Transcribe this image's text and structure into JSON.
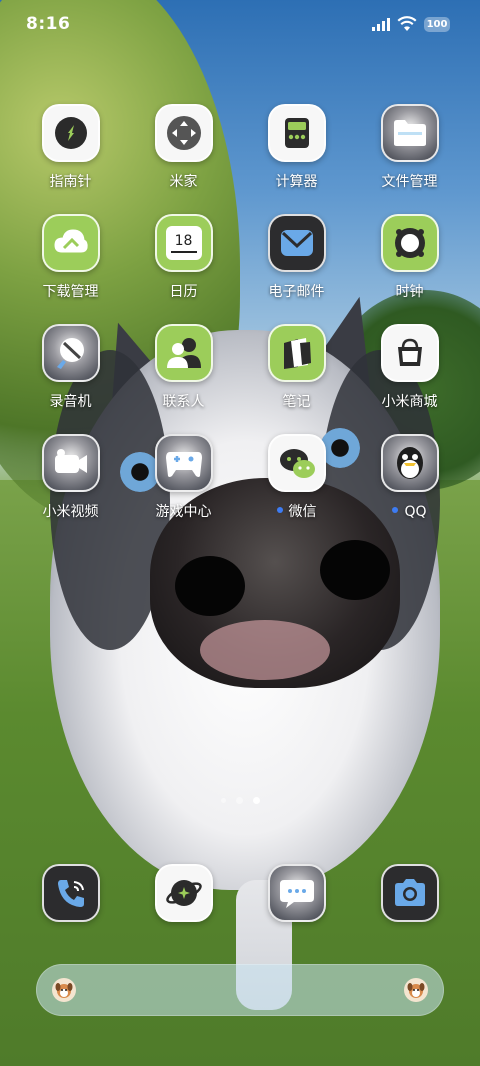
{
  "status_bar": {
    "time": "8:16",
    "battery": "100",
    "signal_icon": "cellular-signal-icon",
    "wifi_icon": "wifi-icon"
  },
  "apps": [
    {
      "label": "指南针",
      "icon": "compass-icon",
      "tile": "white",
      "dot": false
    },
    {
      "label": "米家",
      "icon": "mi-home-icon",
      "tile": "white",
      "dot": false
    },
    {
      "label": "计算器",
      "icon": "calculator-icon",
      "tile": "white",
      "dot": false
    },
    {
      "label": "文件管理",
      "icon": "folder-icon",
      "tile": "photo",
      "dot": false
    },
    {
      "label": "下载管理",
      "icon": "download-cloud-icon",
      "tile": "lime",
      "dot": false
    },
    {
      "label": "日历",
      "icon": "calendar-icon",
      "tile": "lime",
      "dot": false,
      "calendar_day": "18"
    },
    {
      "label": "电子邮件",
      "icon": "mail-icon",
      "tile": "dark",
      "dot": false
    },
    {
      "label": "时钟",
      "icon": "clock-icon",
      "tile": "lime",
      "dot": false
    },
    {
      "label": "录音机",
      "icon": "recorder-icon",
      "tile": "photo",
      "dot": false
    },
    {
      "label": "联系人",
      "icon": "contacts-icon",
      "tile": "lime",
      "dot": false
    },
    {
      "label": "笔记",
      "icon": "notes-icon",
      "tile": "lime",
      "dot": false
    },
    {
      "label": "小米商城",
      "icon": "shopping-bag-icon",
      "tile": "white",
      "dot": false
    },
    {
      "label": "小米视频",
      "icon": "video-camera-icon",
      "tile": "photo",
      "dot": false
    },
    {
      "label": "游戏中心",
      "icon": "gamepad-icon",
      "tile": "photo",
      "dot": false
    },
    {
      "label": "微信",
      "icon": "wechat-icon",
      "tile": "white",
      "dot": true
    },
    {
      "label": "QQ",
      "icon": "qq-penguin-icon",
      "tile": "photo",
      "dot": true
    }
  ],
  "dock": [
    {
      "icon": "phone-icon",
      "tile": "dark"
    },
    {
      "icon": "browser-icon",
      "tile": "white"
    },
    {
      "icon": "messages-icon",
      "tile": "photo"
    },
    {
      "icon": "camera-icon",
      "tile": "dark"
    }
  ],
  "page_indicator": {
    "pages": 2,
    "current": 2
  },
  "search_bar": {
    "left_icon": "dog-avatar-icon",
    "right_icon": "dog-avatar-icon"
  },
  "colors": {
    "accent": "#9ccd5a",
    "notify_dot": "#3d7cf4"
  }
}
